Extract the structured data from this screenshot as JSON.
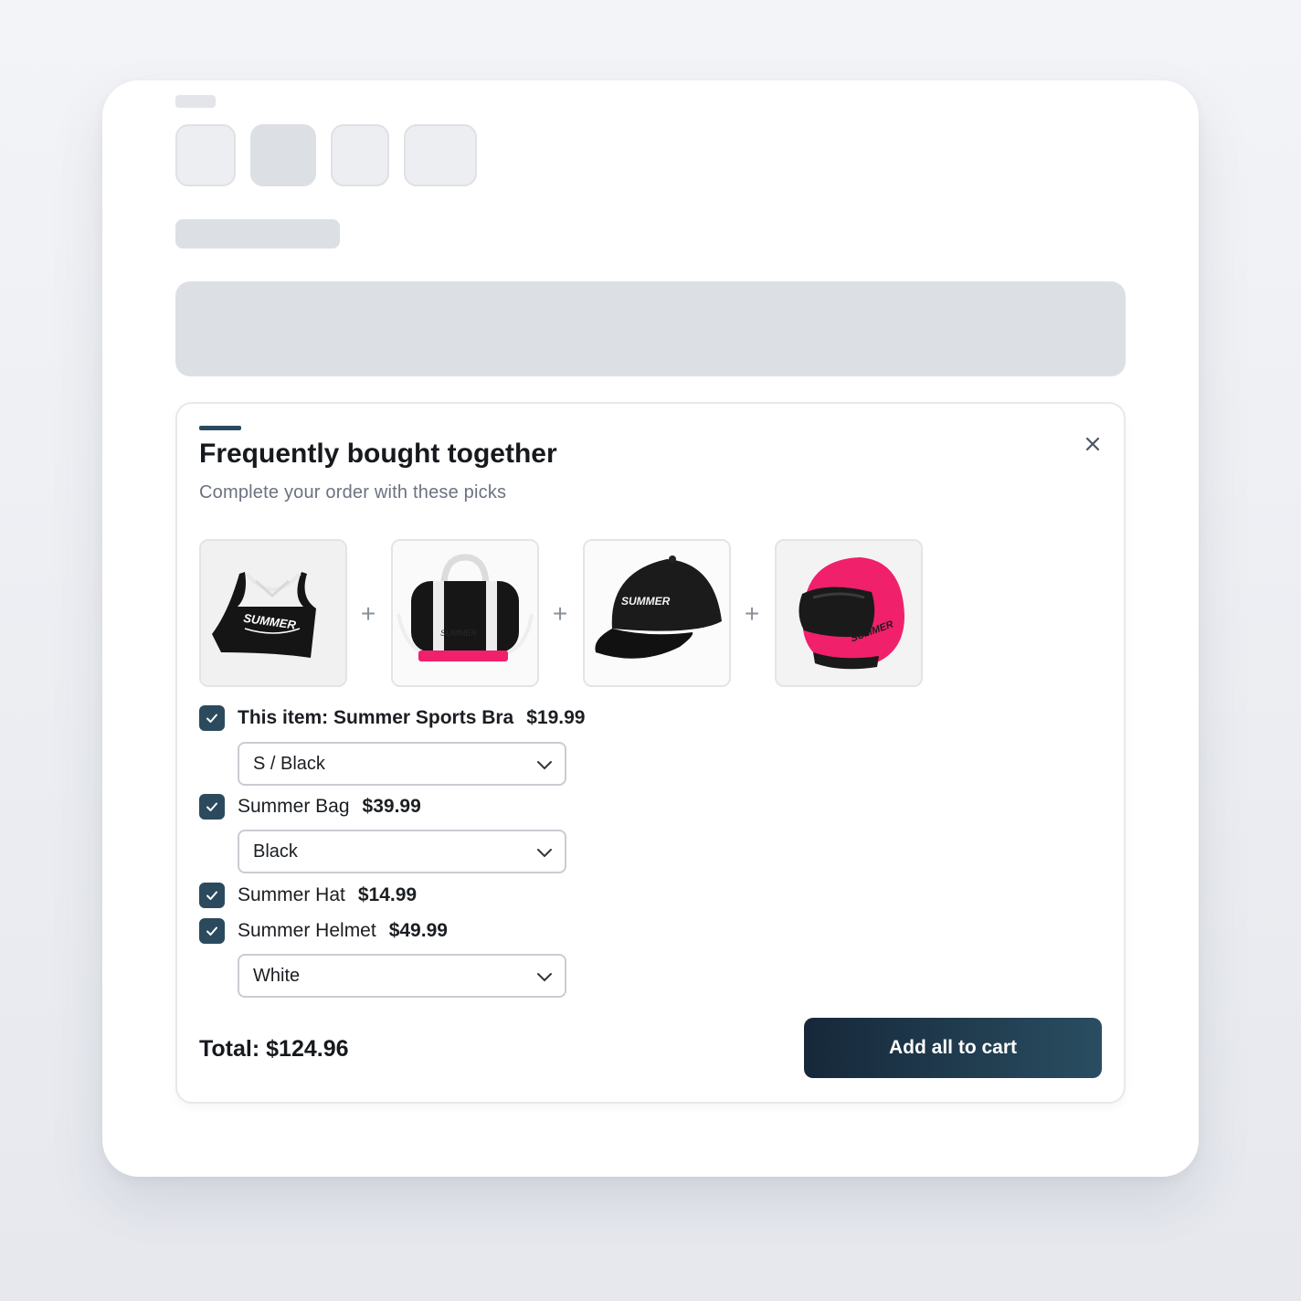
{
  "fbt": {
    "title": "Frequently bought together",
    "subtitle": "Complete your order with these picks",
    "products": [
      {
        "image": "sports-bra-image",
        "brand_text": "SUMMER"
      },
      {
        "image": "duffel-bag-image",
        "brand_text": "SUMMER"
      },
      {
        "image": "cap-image",
        "brand_text": "SUMMER"
      },
      {
        "image": "helmet-image",
        "brand_text": "SUMMER"
      }
    ],
    "plus": "+",
    "items": [
      {
        "label": "This item: Summer Sports Bra",
        "price": "$19.99",
        "checked": true,
        "variant": "S / Black"
      },
      {
        "label": "Summer Bag",
        "price": "$39.99",
        "checked": true,
        "variant": "Black"
      },
      {
        "label": "Summer Hat",
        "price": "$14.99",
        "checked": true
      },
      {
        "label": "Summer Helmet",
        "price": "$49.99",
        "checked": true,
        "variant": "White"
      }
    ],
    "total": "Total: $124.96",
    "cta": "Add all to cart"
  },
  "colors": {
    "accent": "#2a4a5e",
    "checkbox": "#2b4a5d",
    "helmet": "#f0206a",
    "button_start": "#16283a",
    "button_end": "#2a4d61"
  }
}
